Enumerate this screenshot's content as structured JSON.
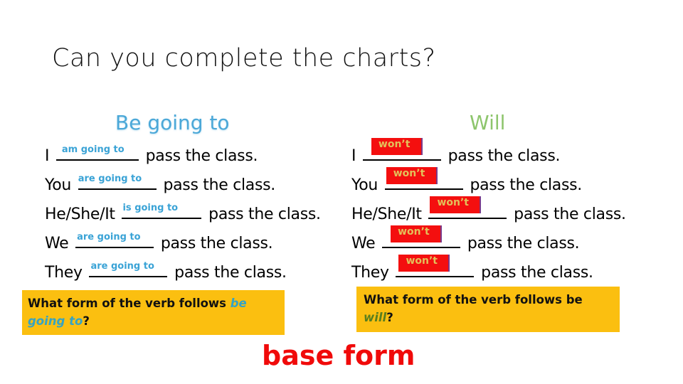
{
  "title": "Can you complete the charts?",
  "left_chart": {
    "heading": "Be going to",
    "rows": [
      {
        "subject": "I",
        "answer": "am going to",
        "rest": "pass the class."
      },
      {
        "subject": "You",
        "answer": "are going to",
        "rest": "pass the class."
      },
      {
        "subject": "He/She/It",
        "answer": "is going to",
        "rest": "pass the class."
      },
      {
        "subject": "We",
        "answer": "are going to",
        "rest": "pass the class."
      },
      {
        "subject": "They",
        "answer": "are going to",
        "rest": "pass the class."
      }
    ],
    "question": {
      "text": "What form of the verb follows ",
      "emphasis": "be going to",
      "end": "?"
    }
  },
  "right_chart": {
    "heading": "Will",
    "rows": [
      {
        "subject": "I",
        "answer": "won’t",
        "rest": "pass the class."
      },
      {
        "subject": "You",
        "answer": "won’t",
        "rest": "pass the class."
      },
      {
        "subject": "He/She/It",
        "answer": "won’t",
        "rest": "pass the class."
      },
      {
        "subject": "We",
        "answer": "won’t",
        "rest": "pass the class."
      },
      {
        "subject": "They",
        "answer": "won’t",
        "rest": "pass the class."
      }
    ],
    "question": {
      "text": "What form of the verb follows be ",
      "emphasis": "will",
      "end": "?"
    }
  },
  "answer": "base form",
  "colors": {
    "going_to_accent": "#4ba8d8",
    "will_accent": "#8dc56c",
    "answer_red": "#f00a0a",
    "question_bg": "#fbbf10",
    "wont_box": "#f40f0f"
  }
}
